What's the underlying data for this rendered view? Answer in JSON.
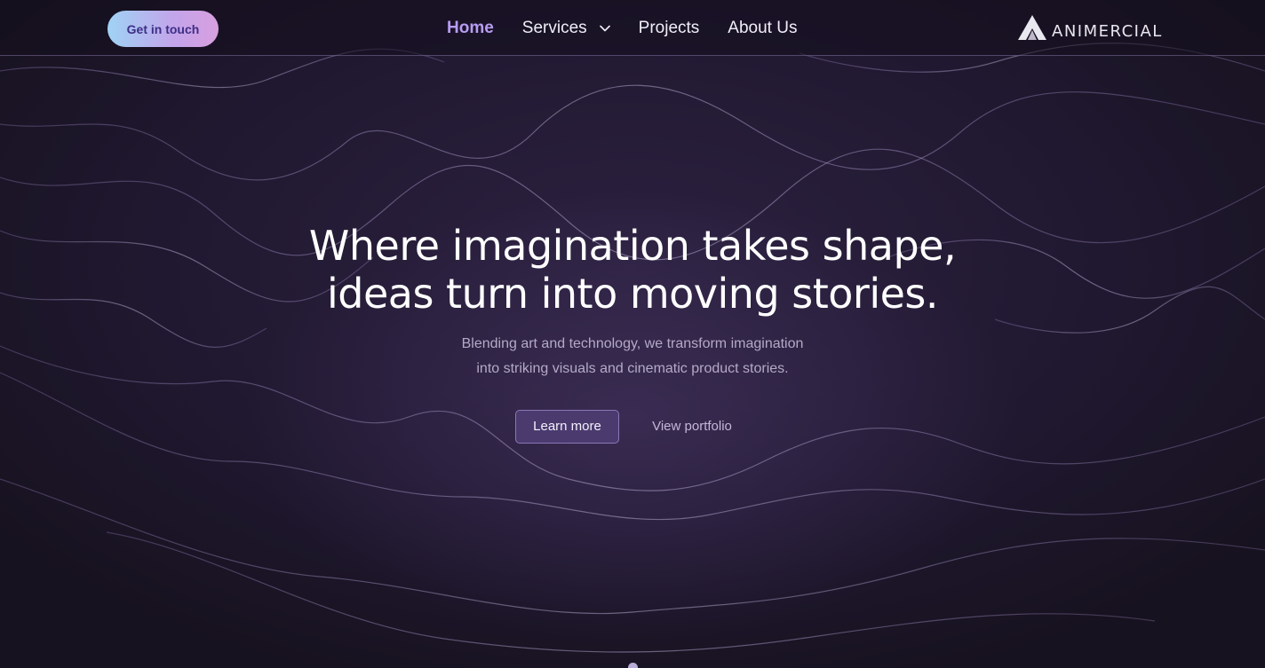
{
  "header": {
    "cta_label": "Get in touch",
    "nav": [
      {
        "label": "Home",
        "active": true
      },
      {
        "label": "Services",
        "has_dropdown": true
      },
      {
        "label": "Projects"
      },
      {
        "label": "About Us"
      }
    ],
    "logo_text": "ANIMERCIAL"
  },
  "hero": {
    "title_line1": "Where imagination takes shape,",
    "title_line2": "ideas turn into moving stories.",
    "subtitle_line1": "Blending art and technology, we transform imagination",
    "subtitle_line2": "into striking visuals and cinematic product stories.",
    "primary_button": "Learn more",
    "secondary_button": "View portfolio"
  },
  "colors": {
    "background": "#201830",
    "accent": "#b79cf2",
    "cta_gradient_start": "#9fd3f5",
    "cta_gradient_end": "#d89fdf",
    "primary_button_bg": "#4a3a6e"
  },
  "icons": {
    "dropdown": "chevron-down-icon",
    "logo": "animercial-logo-mark",
    "scroll": "scroll-indicator-dot"
  }
}
